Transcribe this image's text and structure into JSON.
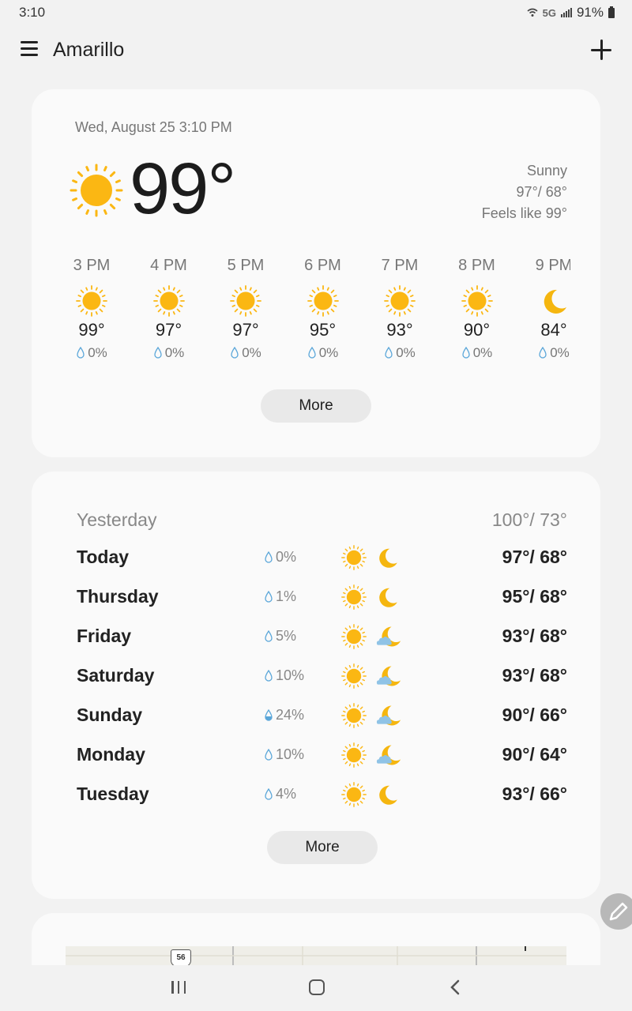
{
  "status_bar": {
    "time": "3:10",
    "network": "5G",
    "battery": "91%"
  },
  "app_bar": {
    "title": "Amarillo"
  },
  "current": {
    "datetime": "Wed, August 25 3:10 PM",
    "temp": "99°",
    "condition": "Sunny",
    "hilo": "97°/ 68°",
    "feels_like": "Feels like 99°",
    "icon": "sun-icon"
  },
  "hourly": [
    {
      "time": "3 PM",
      "temp": "99°",
      "precip": "0%",
      "icon": "sun"
    },
    {
      "time": "4 PM",
      "temp": "97°",
      "precip": "0%",
      "icon": "sun"
    },
    {
      "time": "5 PM",
      "temp": "97°",
      "precip": "0%",
      "icon": "sun"
    },
    {
      "time": "6 PM",
      "temp": "95°",
      "precip": "0%",
      "icon": "sun"
    },
    {
      "time": "7 PM",
      "temp": "93°",
      "precip": "0%",
      "icon": "sun"
    },
    {
      "time": "8 PM",
      "temp": "90°",
      "precip": "0%",
      "icon": "sun"
    },
    {
      "time": "9 PM",
      "temp": "84°",
      "precip": "0%",
      "icon": "moon"
    }
  ],
  "hourly_more_label": "More",
  "daily": {
    "yesterday": {
      "label": "Yesterday",
      "hilo": "100°/ 73°"
    },
    "days": [
      {
        "name": "Today",
        "precip": "0%",
        "day_icon": "sun",
        "night_icon": "moon",
        "hilo": "97°/ 68°"
      },
      {
        "name": "Thursday",
        "precip": "1%",
        "day_icon": "sun",
        "night_icon": "moon",
        "hilo": "95°/ 68°"
      },
      {
        "name": "Friday",
        "precip": "5%",
        "day_icon": "sun",
        "night_icon": "partly-cloudy-night",
        "hilo": "93°/ 68°"
      },
      {
        "name": "Saturday",
        "precip": "10%",
        "day_icon": "sun",
        "night_icon": "partly-cloudy-night",
        "hilo": "93°/ 68°"
      },
      {
        "name": "Sunday",
        "precip": "24%",
        "day_icon": "sun",
        "night_icon": "partly-cloudy-night",
        "hilo": "90°/ 66°"
      },
      {
        "name": "Monday",
        "precip": "10%",
        "day_icon": "sun",
        "night_icon": "partly-cloudy-night",
        "hilo": "90°/ 64°"
      },
      {
        "name": "Tuesday",
        "precip": "4%",
        "day_icon": "sun",
        "night_icon": "moon",
        "hilo": "93°/ 66°"
      }
    ],
    "more_label": "More"
  },
  "map": {
    "route_marker": "56"
  },
  "colors": {
    "sun": "#fbb713",
    "moon": "#f5b60f",
    "cloud": "#8fc3e6",
    "drop": "#5aa6d9",
    "card": "#fafafa",
    "background": "#f2f2f2"
  }
}
